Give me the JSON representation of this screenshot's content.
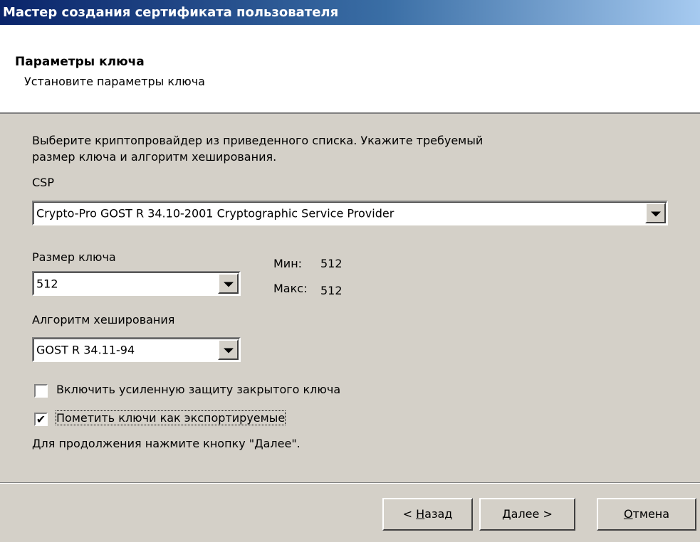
{
  "window": {
    "title": "Мастер создания сертификата пользователя"
  },
  "header": {
    "title": "Параметры ключа",
    "subtitle": "Установите параметры ключа"
  },
  "body": {
    "instruction_line1": "Выберите криптопровайдер из приведенного списка. Укажите требуемый",
    "instruction_line2": "размер ключа и алгоритм хеширования.",
    "csp_label": "CSP",
    "csp_value": "Crypto-Pro GOST R 34.10-2001 Cryptographic Service Provider",
    "key_size_label": "Размер ключа",
    "key_size_value": "512",
    "min_label": "Мин:",
    "min_value": "512",
    "max_label": "Макс:",
    "max_value": "512",
    "hash_label": "Алгоритм хеширования",
    "hash_value": "GOST R 34.11-94",
    "checkbox_strong_protection": {
      "label": "Включить усиленную защиту закрытого ключа",
      "checked": false
    },
    "checkbox_exportable": {
      "label": "Пометить ключи как экспортируемые",
      "checked": true
    },
    "continue_hint": "Для продолжения нажмите кнопку \"Далее\"."
  },
  "footer": {
    "back": {
      "pre": "< ",
      "mnemonic": "Н",
      "rest": "азад"
    },
    "next": {
      "pre": "",
      "mnemonic": "Д",
      "rest": "алее >"
    },
    "cancel": {
      "pre": "",
      "mnemonic": "О",
      "rest": "тмена"
    }
  }
}
